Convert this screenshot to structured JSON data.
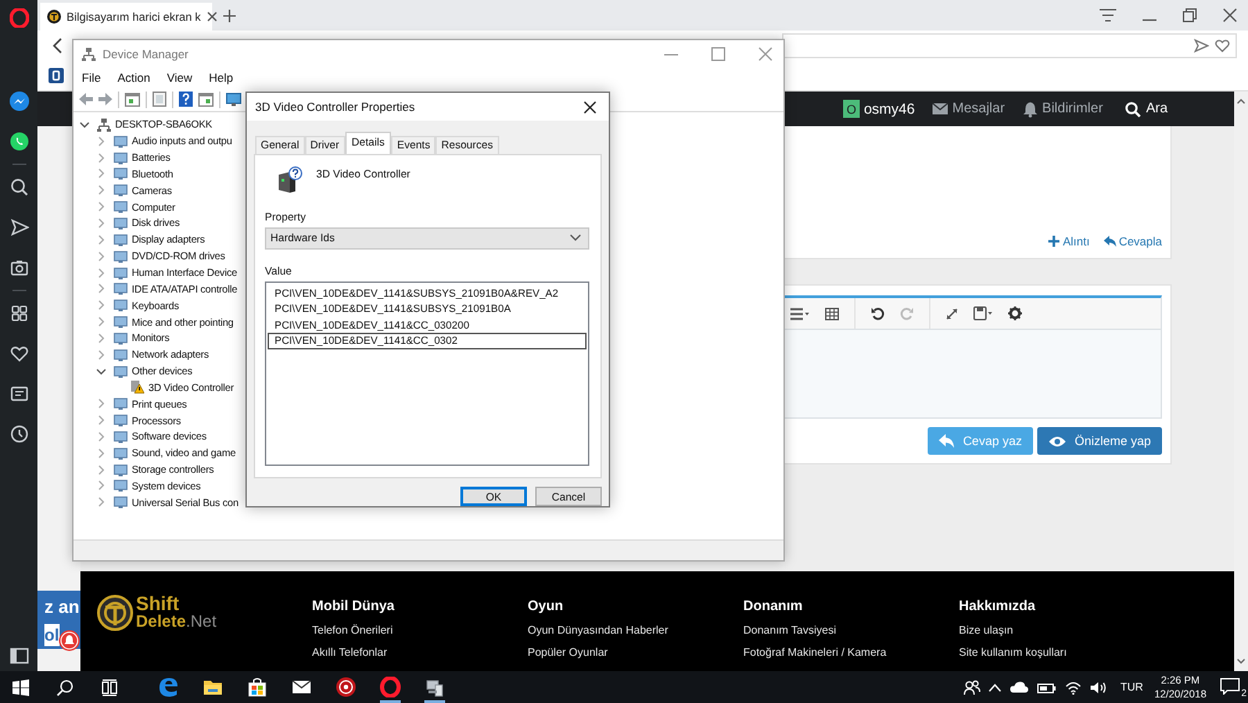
{
  "browser": {
    "tab_title": "Bilgisayarım harici ekran k"
  },
  "site": {
    "nav": {
      "avatar": "O",
      "username": "osmy46",
      "links": [
        {
          "kind": "messages",
          "label": "Mesajlar"
        },
        {
          "kind": "alerts",
          "label": "Bildirimler"
        },
        {
          "kind": "search",
          "label": "Ara"
        }
      ]
    },
    "post_actions": [
      {
        "kind": "quote",
        "label": "Alıntı"
      },
      {
        "kind": "reply",
        "label": "Cevapla"
      }
    ],
    "editor_buttons": [
      {
        "kind": "reply",
        "label": "Cevap yaz"
      },
      {
        "kind": "preview",
        "label": "Önizleme yap"
      }
    ],
    "side_banner": [
      "z an",
      "ol"
    ],
    "footer": {
      "logo": {
        "line1": "Shift",
        "line2": "Delete",
        "suffix": ".Net"
      },
      "columns": [
        {
          "title": "Mobil Dünya",
          "links": [
            "Telefon Önerileri",
            "Akıllı Telefonlar"
          ]
        },
        {
          "title": "Oyun",
          "links": [
            "Oyun Dünyasından Haberler",
            "Popüler Oyunlar"
          ]
        },
        {
          "title": "Donanım",
          "links": [
            "Donanım Tavsiyesi",
            "Fotoğraf Makineleri / Kamera"
          ]
        },
        {
          "title": "Hakkımızda",
          "links": [
            "Bize ulaşın",
            "Site kullanım koşulları"
          ]
        }
      ]
    }
  },
  "device_manager": {
    "title": "Device Manager",
    "menu": [
      "File",
      "Action",
      "View",
      "Help"
    ],
    "tree": {
      "label": "DESKTOP-SBA6OKK",
      "expanded": true,
      "children": [
        {
          "label": "Audio inputs and outpu",
          "expanded": false
        },
        {
          "label": "Batteries",
          "expanded": false
        },
        {
          "label": "Bluetooth",
          "expanded": false
        },
        {
          "label": "Cameras",
          "expanded": false
        },
        {
          "label": "Computer",
          "expanded": false
        },
        {
          "label": "Disk drives",
          "expanded": false
        },
        {
          "label": "Display adapters",
          "expanded": false
        },
        {
          "label": "DVD/CD-ROM drives",
          "expanded": false
        },
        {
          "label": "Human Interface Device",
          "expanded": false
        },
        {
          "label": "IDE ATA/ATAPI controlle",
          "expanded": false
        },
        {
          "label": "Keyboards",
          "expanded": false
        },
        {
          "label": "Mice and other pointing",
          "expanded": false
        },
        {
          "label": "Monitors",
          "expanded": false
        },
        {
          "label": "Network adapters",
          "expanded": false
        },
        {
          "label": "Other devices",
          "expanded": true,
          "children": [
            {
              "label": "3D Video Controller",
              "warning": true
            }
          ]
        },
        {
          "label": "Print queues",
          "expanded": false
        },
        {
          "label": "Processors",
          "expanded": false
        },
        {
          "label": "Software devices",
          "expanded": false
        },
        {
          "label": "Sound, video and game",
          "expanded": false
        },
        {
          "label": "Storage controllers",
          "expanded": false
        },
        {
          "label": "System devices",
          "expanded": false
        },
        {
          "label": "Universal Serial Bus con",
          "expanded": false
        }
      ]
    }
  },
  "properties": {
    "title": "3D Video Controller Properties",
    "tabs": [
      {
        "label": "General",
        "selected": false
      },
      {
        "label": "Driver",
        "selected": false
      },
      {
        "label": "Details",
        "selected": true
      },
      {
        "label": "Events",
        "selected": false
      },
      {
        "label": "Resources",
        "selected": false
      }
    ],
    "device_name": "3D Video Controller",
    "property_label": "Property",
    "property": "Hardware Ids",
    "value_label": "Value",
    "values": [
      {
        "text": "PCI\\VEN_10DE&DEV_1141&SUBSYS_21091B0A&REV_A2",
        "selected": false
      },
      {
        "text": "PCI\\VEN_10DE&DEV_1141&SUBSYS_21091B0A",
        "selected": false
      },
      {
        "text": "PCI\\VEN_10DE&DEV_1141&CC_030200",
        "selected": false
      },
      {
        "text": "PCI\\VEN_10DE&DEV_1141&CC_0302",
        "selected": true
      }
    ],
    "buttons": [
      {
        "label": "OK",
        "default": true
      },
      {
        "label": "Cancel",
        "default": false
      }
    ]
  },
  "taskbar": {
    "apps": [
      {
        "kind": "edge",
        "running": false
      },
      {
        "kind": "explorer",
        "running": false
      },
      {
        "kind": "store",
        "running": false
      },
      {
        "kind": "mail",
        "running": false
      },
      {
        "kind": "redapp",
        "running": false
      },
      {
        "kind": "opera",
        "running": true
      },
      {
        "kind": "devmgr",
        "running": true
      }
    ],
    "language": "TUR",
    "time": "2:26 PM",
    "date": "12/20/2018",
    "notifications": "2"
  }
}
